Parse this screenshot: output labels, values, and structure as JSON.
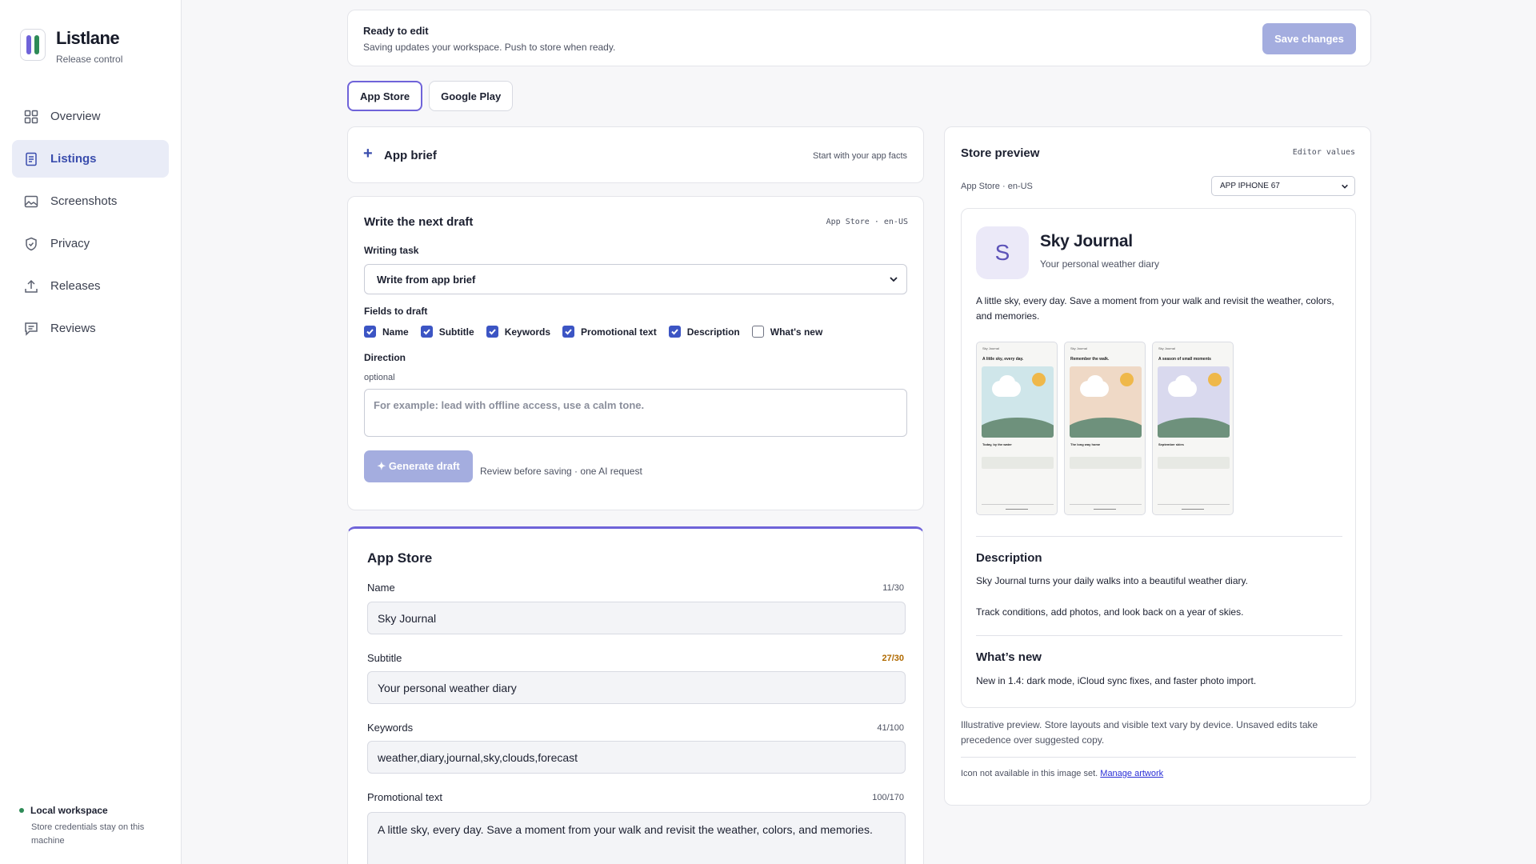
{
  "brand": {
    "name": "Listlane",
    "subtitle": "Release control",
    "colors": [
      "#6f63d9",
      "#2e8b57"
    ]
  },
  "sidebar": {
    "items": [
      {
        "label": "Overview",
        "icon": "grid-icon",
        "active": false
      },
      {
        "label": "Listings",
        "icon": "document-icon",
        "active": true
      },
      {
        "label": "Screenshots",
        "icon": "image-icon",
        "active": false
      },
      {
        "label": "Privacy",
        "icon": "shield-icon",
        "active": false
      },
      {
        "label": "Releases",
        "icon": "upload-icon",
        "active": false
      },
      {
        "label": "Reviews",
        "icon": "chat-icon",
        "active": false
      }
    ],
    "workspace": {
      "title": "Local workspace",
      "desc": "Store credentials stay on this machine"
    }
  },
  "banner": {
    "title": "Ready to edit",
    "desc": "Saving updates your workspace. Push to store when ready.",
    "save_label": "Save changes"
  },
  "tabs": [
    {
      "label": "App Store",
      "active": true
    },
    {
      "label": "Google Play",
      "active": false
    }
  ],
  "brief": {
    "title": "App brief",
    "hint": "Start with your app facts"
  },
  "draft": {
    "title": "Write the next draft",
    "tag": "App Store · en-US",
    "task_label": "Writing task",
    "task_value": "Write from app brief",
    "fields_label": "Fields to draft",
    "fields": [
      {
        "label": "Name",
        "checked": true
      },
      {
        "label": "Subtitle",
        "checked": true
      },
      {
        "label": "Keywords",
        "checked": true
      },
      {
        "label": "Promotional text",
        "checked": true
      },
      {
        "label": "Description",
        "checked": true
      },
      {
        "label": "What's new",
        "checked": false
      }
    ],
    "direction_label": "Direction",
    "direction_optional": "optional",
    "direction_placeholder": "For example: lead with offline access, use a calm tone.",
    "generate_label": "✦ Generate draft",
    "generate_note": "Review before saving · one AI request"
  },
  "appstore": {
    "title": "App Store",
    "name": {
      "label": "Name",
      "count": "11/30",
      "value": "Sky Journal"
    },
    "subtitle": {
      "label": "Subtitle",
      "count": "27/30",
      "value": "Your personal weather diary"
    },
    "keywords": {
      "label": "Keywords",
      "count": "41/100",
      "value": "weather,diary,journal,sky,clouds,forecast"
    },
    "promo": {
      "label": "Promotional text",
      "count": "100/170",
      "value": "A little sky, every day. Save a moment from your walk and revisit the weather, colors, and memories."
    }
  },
  "preview": {
    "title": "Store preview",
    "tag": "Editor values",
    "store": "App Store · en-US",
    "device": "APP IPHONE 67",
    "icon_letter": "S",
    "app_name": "Sky Journal",
    "app_sub": "Your personal weather diary",
    "promo": "A little sky, every day. Save a moment from your walk and revisit the weather, colors, and memories.",
    "screens": [
      {
        "app": "Sky Journal",
        "headline": "A little sky, every day.",
        "caption": "Today, by the water",
        "sky": "#cfe6ea"
      },
      {
        "app": "Sky Journal",
        "headline": "Remember the walk.",
        "caption": "The long way home",
        "sky": "#efd9c6"
      },
      {
        "app": "Sky Journal",
        "headline": "A season of small moments",
        "caption": "September skies",
        "sky": "#d9d9ee"
      }
    ],
    "desc_title": "Description",
    "desc_1": "Sky Journal turns your daily walks into a beautiful weather diary.",
    "desc_2": "Track conditions, add photos, and look back on a year of skies.",
    "new_title": "What’s new",
    "new_text": "New in 1.4: dark mode, iCloud sync fixes, and faster photo import.",
    "footnote": "Illustrative preview. Store layouts and visible text vary by device. Unsaved edits take precedence over suggested copy.",
    "icon_note": "Icon not available in this image set.",
    "manage_link": "Manage artwork"
  }
}
